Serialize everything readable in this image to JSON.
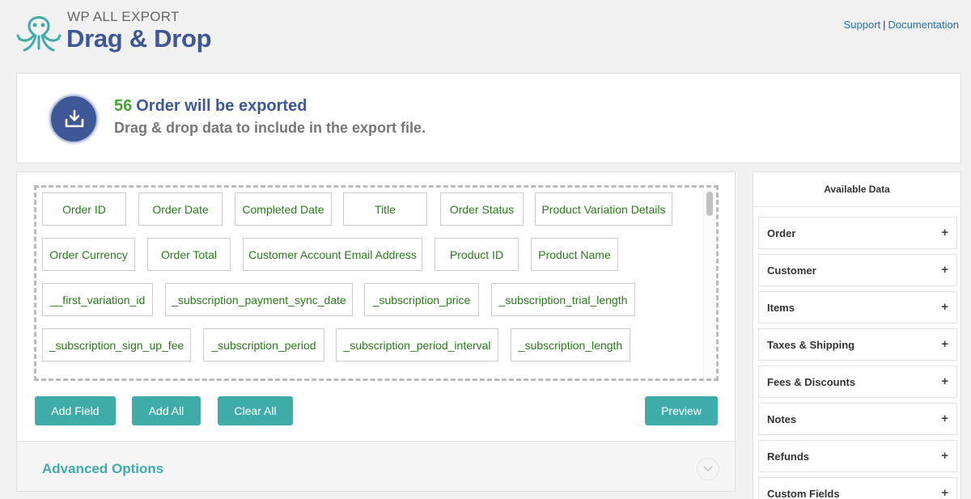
{
  "header": {
    "brand_small": "WP ALL EXPORT",
    "brand_big": "Drag & Drop",
    "support_link": "Support",
    "separator": "|",
    "documentation_link": "Documentation"
  },
  "summary": {
    "count": "56",
    "headline": "Order will be exported",
    "subline": "Drag & drop data to include in the export file."
  },
  "fields": [
    {
      "label": "Order ID"
    },
    {
      "label": "Order Date"
    },
    {
      "label": "Completed Date"
    },
    {
      "label": "Title"
    },
    {
      "label": "Order Status"
    },
    {
      "label": "Product Variation Details"
    },
    {
      "label": "Order Currency"
    },
    {
      "label": "Order Total"
    },
    {
      "label": "Customer Account Email Address"
    },
    {
      "label": "Product ID"
    },
    {
      "label": "Product Name"
    },
    {
      "label": "__first_variation_id"
    },
    {
      "label": "_subscription_payment_sync_date"
    },
    {
      "label": "_subscription_price"
    },
    {
      "label": "_subscription_trial_length"
    },
    {
      "label": "_subscription_sign_up_fee"
    },
    {
      "label": "_subscription_period"
    },
    {
      "label": "_subscription_period_interval"
    },
    {
      "label": "_subscription_length"
    }
  ],
  "buttons": {
    "add_field": "Add Field",
    "add_all": "Add All",
    "clear_all": "Clear All",
    "preview": "Preview"
  },
  "advanced": {
    "title": "Advanced Options",
    "chevron_icon": "chevron-down-icon"
  },
  "sidebar": {
    "title": "Available Data",
    "items": [
      {
        "label": "Order"
      },
      {
        "label": "Customer"
      },
      {
        "label": "Items"
      },
      {
        "label": "Taxes & Shipping"
      },
      {
        "label": "Fees & Discounts"
      },
      {
        "label": "Notes"
      },
      {
        "label": "Refunds"
      },
      {
        "label": "Custom Fields"
      }
    ],
    "expand_glyph": "+"
  },
  "colors": {
    "brand_blue": "#3e5797",
    "teal": "#40aca9",
    "field_green": "#2a7a1c",
    "count_green": "#46a338"
  }
}
